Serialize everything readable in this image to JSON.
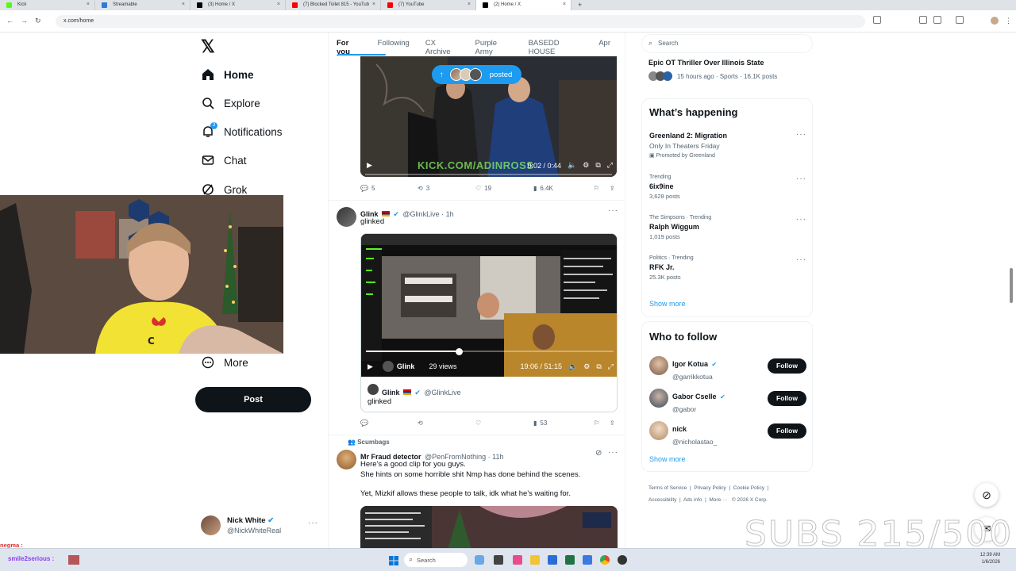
{
  "browser": {
    "tabs": [
      {
        "label": "Kick",
        "color": "#53fc18"
      },
      {
        "label": "Streamable",
        "color": "#2b7bd8"
      },
      {
        "label": "(3) Home / X",
        "color": "#000000"
      },
      {
        "label": "(7) Blocked Toilet 815 - YouTub",
        "color": "#ff0000"
      },
      {
        "label": "(7) YouTube",
        "color": "#ff0000"
      },
      {
        "label": "(2) Home / X",
        "color": "#000000"
      }
    ],
    "url": "x.com/home"
  },
  "nav": {
    "logo": "𝕏",
    "items": [
      {
        "label": "Home",
        "icon": "home-icon"
      },
      {
        "label": "Explore",
        "icon": "search-icon"
      },
      {
        "label": "Notifications",
        "icon": "bell-icon",
        "badge": "3"
      },
      {
        "label": "Chat",
        "icon": "mail-icon"
      },
      {
        "label": "Grok",
        "icon": "grok-icon"
      },
      {
        "label": "More",
        "icon": "more-circle-icon"
      }
    ],
    "post_label": "Post",
    "account": {
      "name": "Nick White",
      "handle": "@NickWhiteReal"
    }
  },
  "feed": {
    "tabs": [
      "For you",
      "Following",
      "CX Archive",
      "Purple Army",
      "BASEDD HOUSE",
      "Apr"
    ],
    "posted_pill": "posted",
    "post1": {
      "watermark": "KICK.COM/ADINROSS",
      "time": "0:02 / 0:44",
      "replies": "5",
      "reposts": "3",
      "likes": "19",
      "views": "6.4K"
    },
    "post2": {
      "name": "Glink",
      "handle": "@GlinkLive · 1h",
      "text": "glinked",
      "video_name": "Glink",
      "video_views": "29 views",
      "time": "19:06 / 51:15",
      "quote_name": "Glink",
      "quote_handle": "@GlinkLive",
      "quote_text": "glinked",
      "views": "53"
    },
    "post3": {
      "community": "Scumbags",
      "name": "Mr Fraud detector",
      "handle": "@PenFromNothing · 11h",
      "line1": "Here's a good clip for you guys.",
      "line2": "She hints on some horrible shit Nmp has done behind the scenes.",
      "line3": "Yet, Mizkif allows these people to talk, idk what he's waiting for."
    }
  },
  "sidebar": {
    "search_placeholder": "Search",
    "top_story": {
      "title": "Epic OT Thriller Over Illinois State",
      "meta": "15 hours ago · Sports · 16.1K posts"
    },
    "happening_title": "What’s happening",
    "promo": {
      "title": "Greenland 2: Migration",
      "sub": "Only In Theaters Friday",
      "promoted": "Promoted by Greenland"
    },
    "trends": [
      {
        "context": "Trending",
        "name": "6ix9ine",
        "posts": "3,628 posts"
      },
      {
        "context": "The Simpsons · Trending",
        "name": "Ralph Wiggum",
        "posts": "1,019 posts"
      },
      {
        "context": "Politics · Trending",
        "name": "RFK Jr.",
        "posts": "25.3K posts"
      }
    ],
    "show_more": "Show more",
    "who_title": "Who to follow",
    "follow": [
      {
        "name": "Igor Kotua",
        "handle": "@garrikkotua",
        "verified": true
      },
      {
        "name": "Gabor Cselle",
        "handle": "@gabor",
        "verified": true
      },
      {
        "name": "nick",
        "handle": "@nicholastao_",
        "verified": false
      }
    ],
    "follow_label": "Follow",
    "footer": [
      "Terms of Service",
      "Privacy Policy",
      "Cookie Policy",
      "Accessibility",
      "Ads info",
      "More ···",
      "© 2026 X Corp."
    ]
  },
  "overlay": {
    "subs": "SUBS 215/500",
    "chat1": "negma :",
    "chat2": "smile2serious :"
  },
  "taskbar": {
    "search": "Search",
    "time": "12:39 AM",
    "date": "1/6/2026"
  }
}
